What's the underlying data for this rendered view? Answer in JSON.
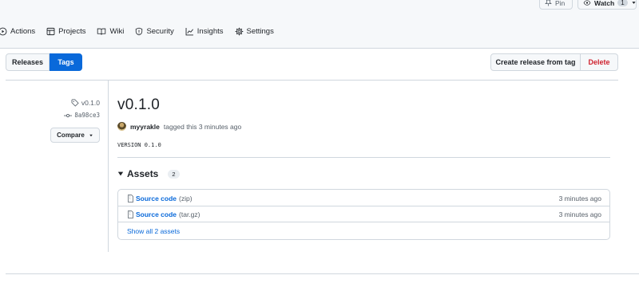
{
  "header": {
    "pin_label": "Pin",
    "watch_label": "Watch",
    "watch_count": "1"
  },
  "nav": {
    "items": [
      {
        "label": "Actions",
        "icon": "play-circle-icon"
      },
      {
        "label": "Projects",
        "icon": "table-icon"
      },
      {
        "label": "Wiki",
        "icon": "book-icon"
      },
      {
        "label": "Security",
        "icon": "shield-icon"
      },
      {
        "label": "Insights",
        "icon": "graph-icon"
      },
      {
        "label": "Settings",
        "icon": "gear-icon"
      }
    ]
  },
  "toolbar": {
    "releases_label": "Releases",
    "tags_label": "Tags",
    "create_release_label": "Create release from tag",
    "delete_label": "Delete"
  },
  "sidebar": {
    "tag_name": "v0.1.0",
    "commit_sha": "8a98ce3",
    "compare_label": "Compare"
  },
  "release": {
    "title": "v0.1.0",
    "author": "myyrakle",
    "tagged_text": "tagged this 3 minutes ago",
    "body": "VERSION 0.1.0"
  },
  "assets": {
    "heading": "Assets",
    "count": "2",
    "items": [
      {
        "name": "Source code",
        "format": "(zip)",
        "time": "3 minutes ago"
      },
      {
        "name": "Source code",
        "format": "(tar.gz)",
        "time": "3 minutes ago"
      }
    ],
    "show_all_label": "Show all 2 assets"
  },
  "colors": {
    "accent": "#0969da",
    "danger": "#cf222e",
    "border": "#d0d7de",
    "muted": "#57606a"
  }
}
